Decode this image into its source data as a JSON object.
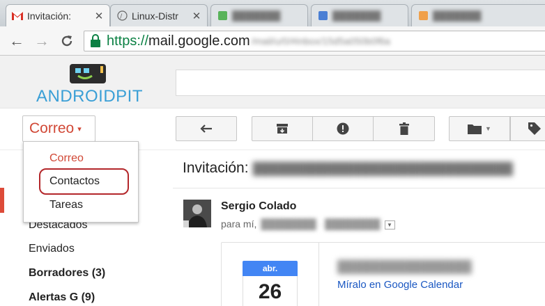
{
  "browser": {
    "tabs": [
      {
        "title": "Invitación: ",
        "favicon": "gmail-icon",
        "active": true
      },
      {
        "title": "Linux-Distr",
        "favicon": "linux-distro-icon",
        "active": false
      },
      {
        "title": "",
        "favicon": "green-icon",
        "active": false,
        "blurred": true
      },
      {
        "title": "",
        "favicon": "blue-icon",
        "active": false,
        "blurred": true
      },
      {
        "title": "",
        "favicon": "orange-icon",
        "active": false,
        "blurred": true
      }
    ],
    "address": {
      "secure": "https://",
      "host": "mail.google.com",
      "path": "/mail/u/0/#inbox/15d5a050b0f6a"
    }
  },
  "header": {
    "brand": "ANDROIDPIT"
  },
  "toolbar": {
    "mode_label": "Correo",
    "mode_caret": "▾"
  },
  "switcher_menu": {
    "items": [
      {
        "label": "Correo",
        "current": true
      },
      {
        "label": "Contactos",
        "highlighted": true
      },
      {
        "label": "Tareas"
      }
    ]
  },
  "sidebar": {
    "items": [
      {
        "label": "Destacados",
        "bold": false
      },
      {
        "label": "Enviados",
        "bold": false
      },
      {
        "label": "Borradores (3)",
        "bold": true
      },
      {
        "label": "Alertas G (9)",
        "bold": true
      }
    ]
  },
  "message": {
    "subject_prefix": "Invitación:",
    "sender": "Sergio Colado",
    "to": "para mí,"
  },
  "calendar_card": {
    "month": "abr.",
    "day": "26",
    "link": "Míralo en Google Calendar"
  },
  "colors": {
    "accent_red": "#d14836",
    "link_blue": "#1a57c2",
    "calendar_blue": "#4285f4",
    "brand_blue": "#3a9fd6"
  }
}
